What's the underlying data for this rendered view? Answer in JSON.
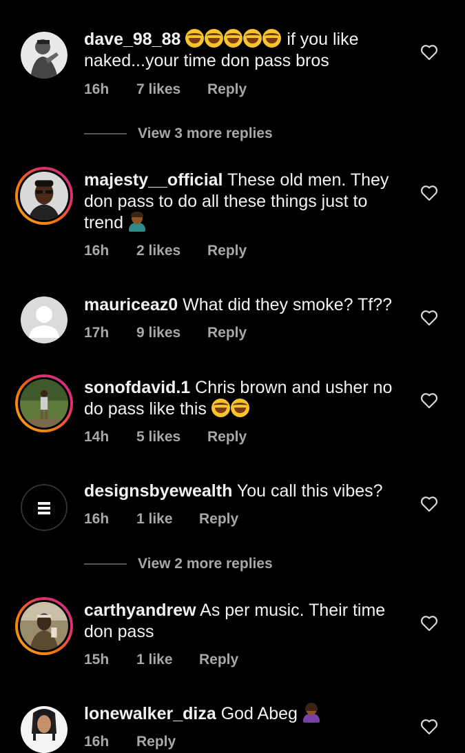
{
  "colors": {
    "background": "#000000",
    "text": "#f2f2f2",
    "meta": "#a8a8a8",
    "story_ring": "#e1306c"
  },
  "comments": [
    {
      "username": "dave_98_88",
      "text_before_emoji": "",
      "emoji": "face-with-tears-of-joy x5",
      "text": "if you like naked...your time don pass bros",
      "time": "16h",
      "likes": "7 likes",
      "reply": "Reply",
      "avatar": "grayscale-photo-person",
      "story_ring": false
    },
    {
      "username": "majesty__official",
      "text": "These old men. They don pass to do all these things just to trend",
      "emoji": "man-facepalming",
      "time": "16h",
      "likes": "2 likes",
      "reply": "Reply",
      "avatar": "man-with-sunglasses",
      "story_ring": true
    },
    {
      "username": "mauriceaz0",
      "text": "What did they smoke? Tf??",
      "time": "17h",
      "likes": "9 likes",
      "reply": "Reply",
      "avatar": "default-avatar",
      "story_ring": false
    },
    {
      "username": "sonofdavid.1",
      "text": "Chris brown and usher no do pass like this",
      "emoji": "face-with-tears-of-joy x2",
      "time": "14h",
      "likes": "5 likes",
      "reply": "Reply",
      "avatar": "person-standing-outdoors",
      "story_ring": true
    },
    {
      "username": "designsbyewealth",
      "text": "You call this vibes?",
      "time": "16h",
      "likes": "1 like",
      "reply": "Reply",
      "avatar": "menu-logo",
      "story_ring": false
    },
    {
      "username": "carthyandrew",
      "text": "As per music.  Their time don pass",
      "time": "15h",
      "likes": "1 like",
      "reply": "Reply",
      "avatar": "man-with-headband",
      "story_ring": true
    },
    {
      "username": "lonewalker_diza",
      "text": "God Abeg",
      "emoji": "woman-facepalming",
      "time": "16h",
      "likes": "",
      "reply": "Reply",
      "avatar": "woman-cartoon",
      "story_ring": false
    }
  ],
  "view_replies": [
    {
      "label": "View 3 more replies"
    },
    {
      "label": "View 2 more replies"
    }
  ],
  "icons": {
    "like": "heart-outline-icon"
  }
}
